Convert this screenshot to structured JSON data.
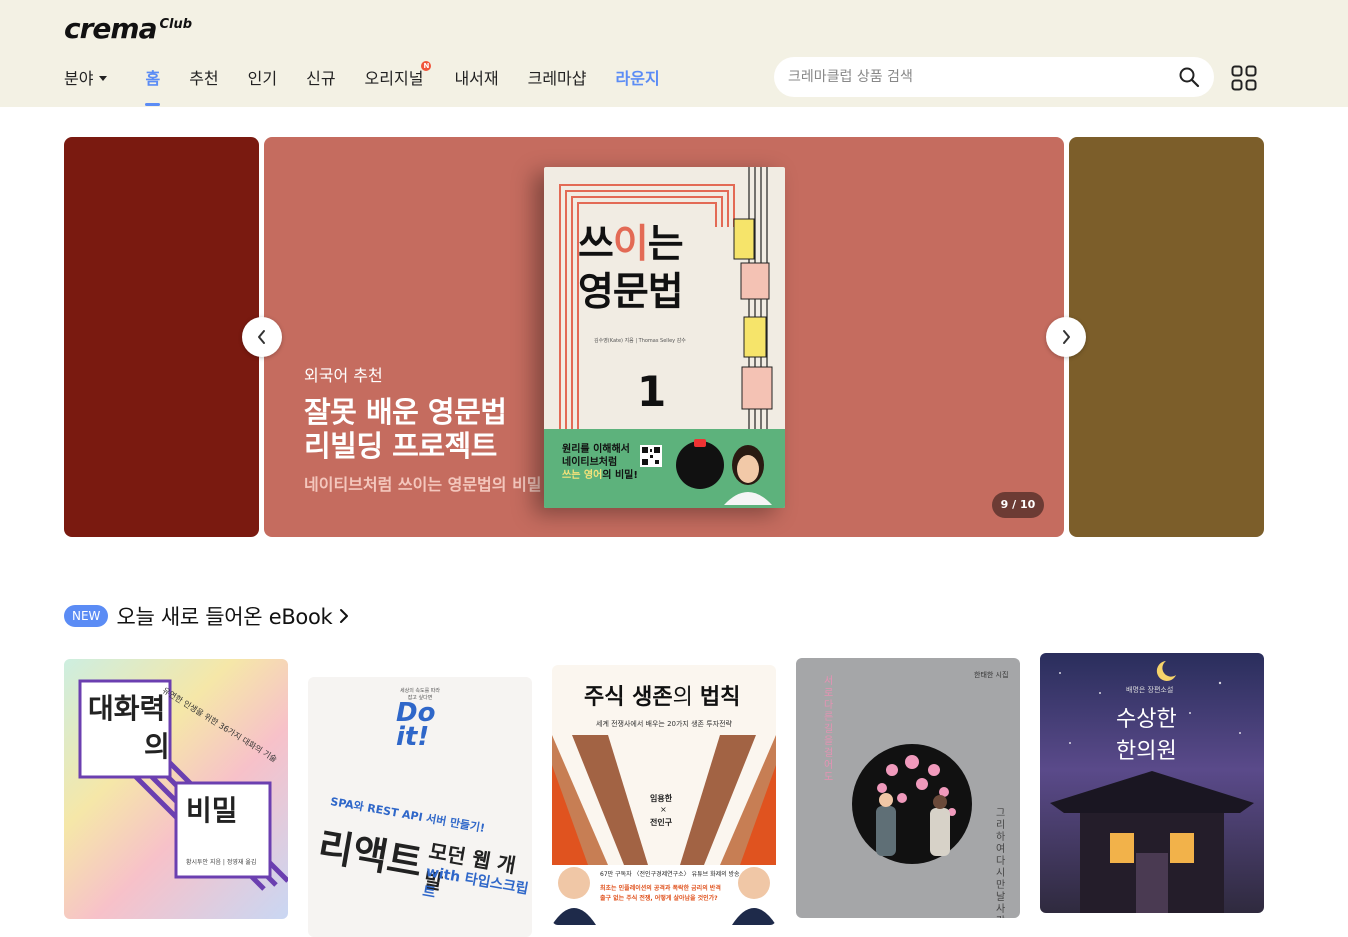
{
  "brand": {
    "name": "crema",
    "sub": "Club"
  },
  "nav": {
    "items": [
      {
        "label": "분야",
        "type": "dropdown"
      },
      {
        "label": "홈",
        "state": "active"
      },
      {
        "label": "추천"
      },
      {
        "label": "인기"
      },
      {
        "label": "신규"
      },
      {
        "label": "오리지널",
        "badge": "N"
      },
      {
        "label": "내서재"
      },
      {
        "label": "크레마샵"
      },
      {
        "label": "라운지",
        "state": "highlight"
      }
    ]
  },
  "search": {
    "placeholder": "크레마클럽 상품 검색",
    "icon": "search-icon"
  },
  "apps_icon": "grid-icon",
  "banner": {
    "category": "외국어 추천",
    "title_line1": "잘못 배운 영문법",
    "title_line2": "리빌딩 프로젝트",
    "subtitle": "네이티브처럼 쓰이는 영문법의 비밀",
    "counter": "9 / 10",
    "book": {
      "title_line1_a": "쓰",
      "title_line1_b": "이",
      "title_line1_c": "는",
      "title_line2": "영문법",
      "author": "김수영(Kate) 지음 | Thomas Selley 감수",
      "volume": "1",
      "green_line1": "원리를 이해해서",
      "green_line2": "네이티브처럼",
      "green_line3_hl": "쓰는 영어",
      "green_line3_rest": "의 비밀!"
    },
    "colors": {
      "left": "#7a1a10",
      "main": "#c56c5f",
      "right": "#7c5e2a"
    }
  },
  "section": {
    "badge": "NEW",
    "title": "오늘 새로 들어온 eBook"
  },
  "books": [
    {
      "title_a": "대화력",
      "title_b": "의",
      "title_c": "비밀",
      "tagline": "유연한 인생을 위한 36가지 대화의 기술",
      "author": "황시투안 지음 | 정영재 옮김"
    },
    {
      "pre": "세상의 속도를 따라잡고 싶다면",
      "brand": "Do it!",
      "sub1": "SPA와 REST API 서버 만들기!",
      "title": "리액트",
      "title2": "모던 웹 개발",
      "with": "with 타입스크립트"
    },
    {
      "title_a": "주식 생존",
      "title_b": "의 ",
      "title_c": "법칙",
      "sub": "세계 전쟁사에서 배우는 20가지 생존 투자전략",
      "author1": "임용한",
      "x": "×",
      "author2": "전인구",
      "bottom1": "67만 구독자 〈전인구경제연구소〉 유튜브 화제의 방송",
      "bottom2": "최초는 인플레이션의 공격과 폭락한 금리의 반격",
      "bottom3": "출구 없는 주식 전쟁, 어떻게 살아남을 것인가?"
    },
    {
      "author": "한태한 시집",
      "title": "서로 다른 길을 걸어도",
      "title2": "그리하여 다시 만날 사랑"
    },
    {
      "sub": "배명은 장편소설",
      "title_a": "수상한",
      "title_b": "한의원"
    }
  ]
}
